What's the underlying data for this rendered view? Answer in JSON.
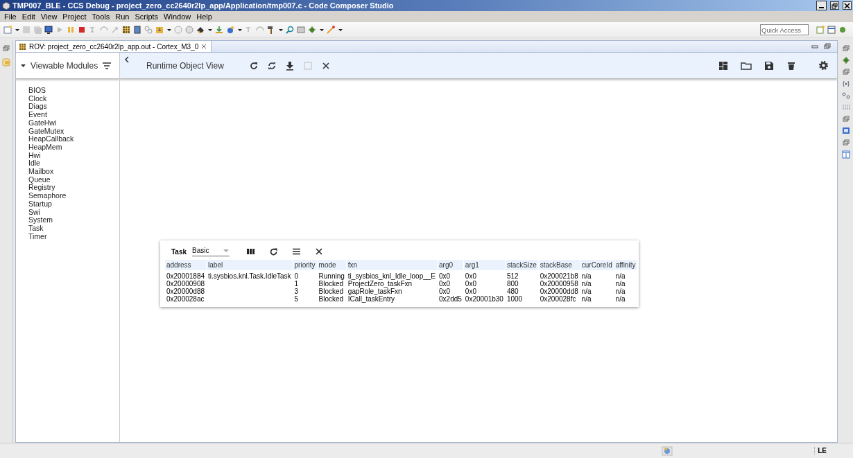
{
  "window": {
    "title": "TMP007_BLE - CCS Debug - project_zero_cc2640r2lp_app/Application/tmp007.c - Code Composer Studio"
  },
  "menu": [
    "File",
    "Edit",
    "View",
    "Project",
    "Tools",
    "Run",
    "Scripts",
    "Window",
    "Help"
  ],
  "quick_access": {
    "placeholder": "Quick Access"
  },
  "editor_tab": {
    "label": "ROV: project_zero_cc2640r2lp_app.out - Cortex_M3_0"
  },
  "rov": {
    "modules_header": "Viewable Modules",
    "title": "Runtime Object View",
    "modules": [
      "BIOS",
      "Clock",
      "Diags",
      "Event",
      "GateHwi",
      "GateMutex",
      "HeapCallback",
      "HeapMem",
      "Hwi",
      "Idle",
      "Mailbox",
      "Queue",
      "Registry",
      "Semaphore",
      "Startup",
      "Swi",
      "System",
      "Task",
      "Timer"
    ],
    "task_panel": {
      "title": "Task",
      "view_select": "Basic",
      "columns": [
        "address",
        "label",
        "priority",
        "mode",
        "fxn",
        "arg0",
        "arg1",
        "stackSize",
        "stackBase",
        "curCoreId",
        "affinity"
      ],
      "rows": [
        [
          "0x20001884",
          "ti.sysbios.knl.Task.IdleTask",
          "0",
          "Running",
          "ti_sysbios_knl_Idle_loop__E",
          "0x0",
          "0x0",
          "512",
          "0x200021b8",
          "n/a",
          "n/a"
        ],
        [
          "0x20000908",
          "",
          "1",
          "Blocked",
          "ProjectZero_taskFxn",
          "0x0",
          "0x0",
          "800",
          "0x20000958",
          "n/a",
          "n/a"
        ],
        [
          "0x20000d88",
          "",
          "3",
          "Blocked",
          "gapRole_taskFxn",
          "0x0",
          "0x0",
          "480",
          "0x20000dd8",
          "n/a",
          "n/a"
        ],
        [
          "0x200028ac",
          "",
          "5",
          "Blocked",
          "ICall_taskEntry",
          "0x2dd5",
          "0x20001b30",
          "1000",
          "0x200028fc",
          "n/a",
          "n/a"
        ]
      ]
    }
  },
  "status_bar": {
    "byte_order": "LE"
  }
}
